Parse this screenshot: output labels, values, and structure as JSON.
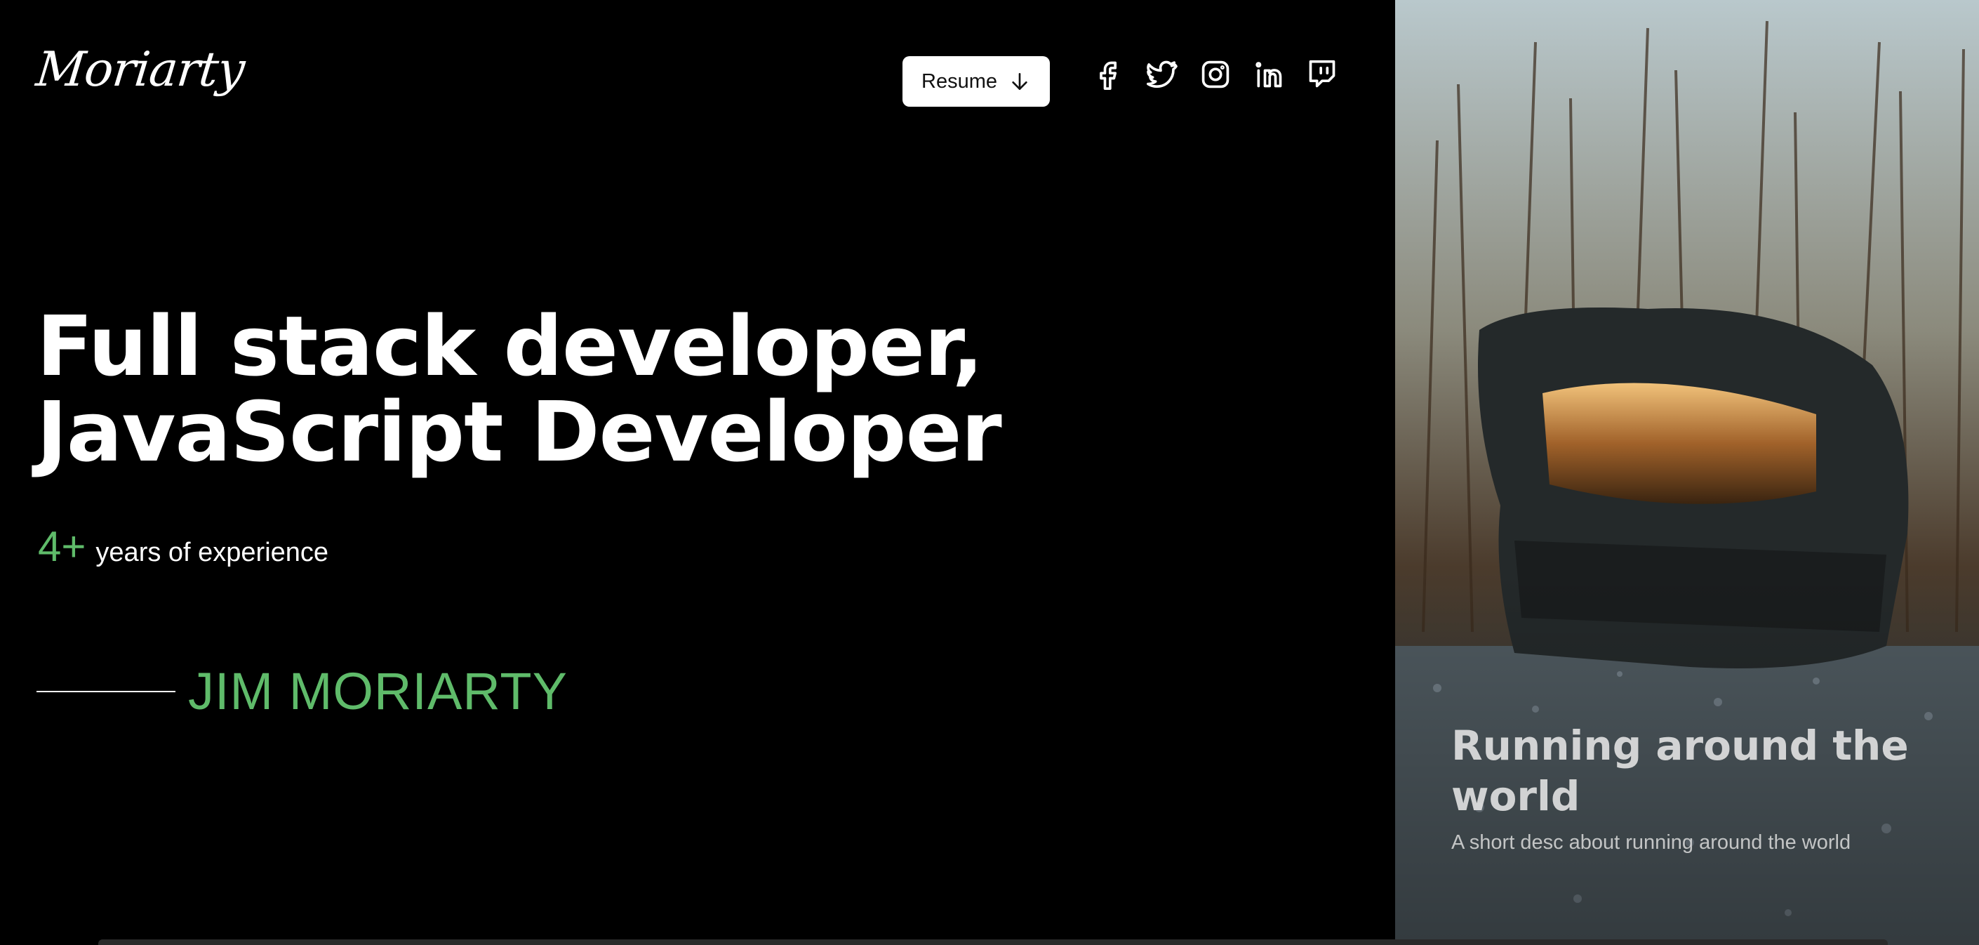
{
  "header": {
    "logo": "Moriarty",
    "resume_label": "Resume",
    "socials": [
      {
        "name": "facebook-icon"
      },
      {
        "name": "twitter-icon"
      },
      {
        "name": "instagram-icon"
      },
      {
        "name": "linkedin-icon"
      },
      {
        "name": "twitch-icon"
      }
    ]
  },
  "hero": {
    "headline_line1": "Full stack developer,",
    "headline_line2": "JavaScript Developer",
    "experience_value": "4+",
    "experience_label": "years of experience",
    "name": "JIM MORIARTY"
  },
  "feature": {
    "title": "Running around the world",
    "description": "A short desc about running around the world"
  },
  "colors": {
    "background": "#000000",
    "accent_green": "#5fbb6a",
    "text": "#ffffff",
    "button_bg": "#ffffff"
  }
}
